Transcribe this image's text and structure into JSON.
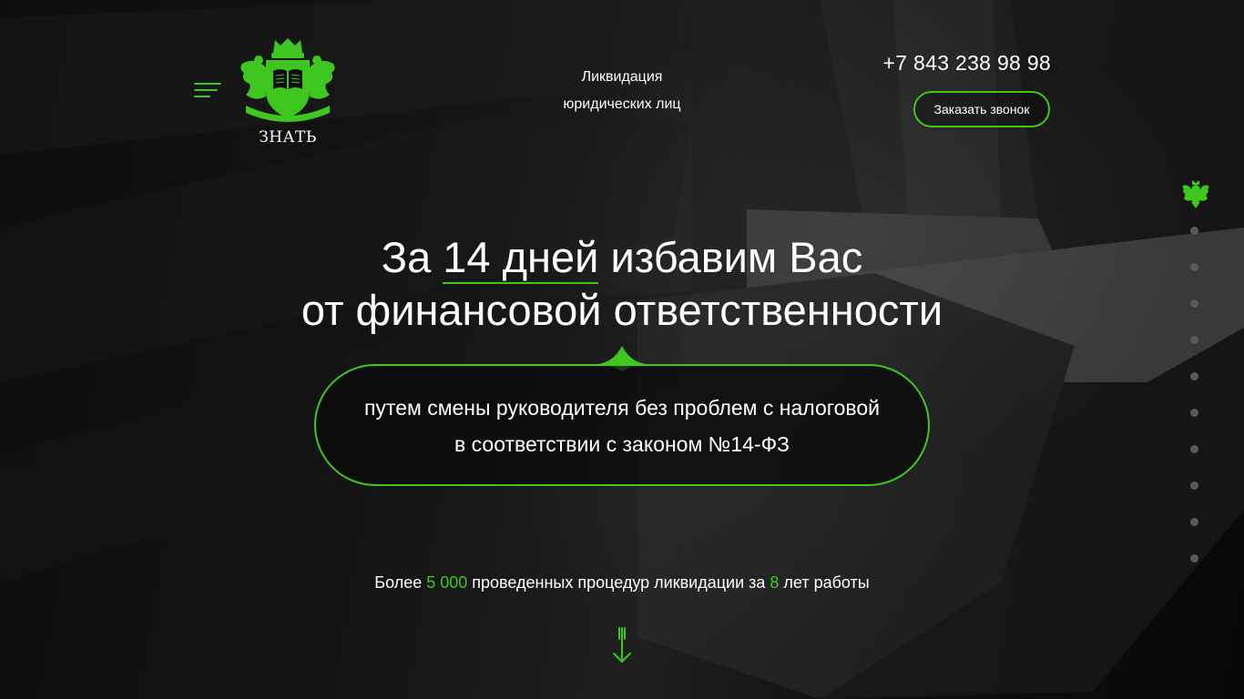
{
  "colors": {
    "accent": "#3ec81f",
    "text": "#ffffff",
    "dot": "#5a5a5a"
  },
  "header": {
    "logo_text": "ЗНАТЬ",
    "tagline_line1": "Ликвидация",
    "tagline_line2": "юридических лиц",
    "phone": "+7 843 238 98 98",
    "callback_label": "Заказать звонок"
  },
  "hero": {
    "title_part1": "За ",
    "title_highlight": "14 дней",
    "title_part2": " избавим Вас",
    "title_line2": "от финансовой ответственности",
    "pill_line1": "путем смены руководителя без проблем с налоговой",
    "pill_line2": "в соответствии с законом №14-ФЗ"
  },
  "stats": {
    "prefix": "Более ",
    "count": "5 000",
    "middle": " проведенных процедур ликвидации за ",
    "years": "8",
    "suffix": " лет работы"
  },
  "icons": {
    "menu": "menu-icon",
    "logo": "crest-logo-icon",
    "side_emblem": "eagle-emblem-icon",
    "scroll": "arrow-down-icon"
  },
  "side_nav": {
    "dot_count": 10
  }
}
